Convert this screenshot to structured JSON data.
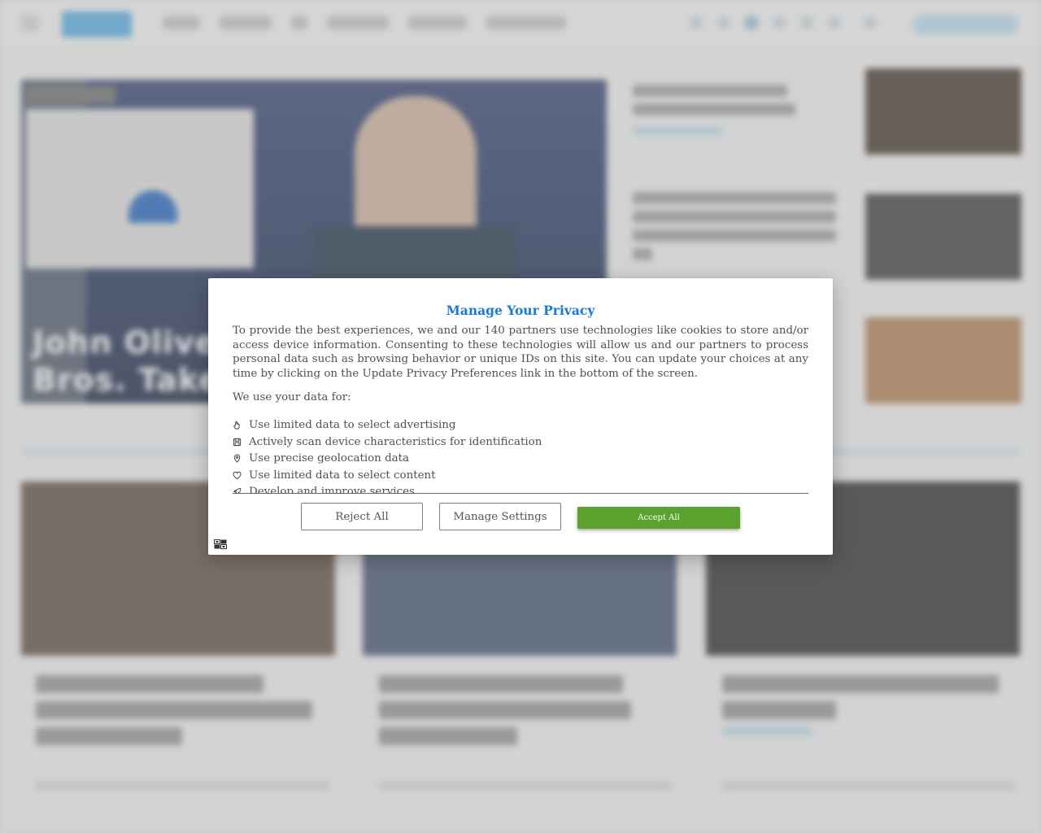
{
  "background_page": {
    "hero_title_fragment": "John Oliver S\nBros. Takeove"
  },
  "privacy_modal": {
    "title": "Manage Your Privacy",
    "intro": "To provide the best experiences, we and our 140 partners use technologies like cookies to store and/or access device information. Consenting to these technologies will allow us and our partners to process personal data such as browsing behavior or unique IDs on this site. You can update your choices at any time by clicking on the Update Privacy Preferences link in the bottom of the screen.",
    "use_label": "We use your data for:",
    "purposes": [
      {
        "icon": "hand-icon",
        "label": "Use limited data to select advertising"
      },
      {
        "icon": "floppy-disk-icon",
        "label": "Actively scan device characteristics for identification"
      },
      {
        "icon": "location-pin-icon",
        "label": "Use precise geolocation data"
      },
      {
        "icon": "heart-icon",
        "label": "Use limited data to select content"
      },
      {
        "icon": "rocket-icon",
        "label": "Develop and improve services"
      }
    ],
    "buttons": {
      "reject": "Reject All",
      "manage": "Manage Settings",
      "accept": "Accept All"
    },
    "accent_color": "#1a79d5",
    "accept_color": "#5ba12e"
  }
}
